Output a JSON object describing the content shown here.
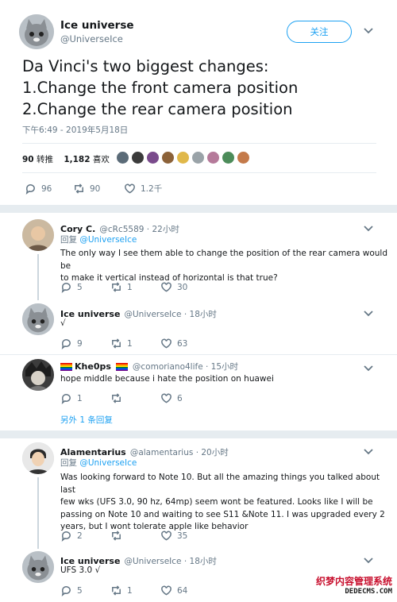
{
  "main_tweet": {
    "name": "Ice universe",
    "handle": "@UniverseIce",
    "follow_label": "关注",
    "text_line1": "Da Vinci's two biggest changes:",
    "text_line2": "1.Change the front camera position",
    "text_line3": "2.Change the rear camera position",
    "timestamp": "下午6:49 - 2019年5月18日",
    "retweets_count": "90",
    "retweets_label": "转推",
    "likes_count": "1,182",
    "likes_label": "喜欢",
    "actions": {
      "replies": "96",
      "retweets": "90",
      "likes": "1.2千"
    }
  },
  "replies": [
    {
      "name": "Cory C.",
      "handle_time": "@cRc5589 · 22小时",
      "reply_prefix": "回复",
      "reply_to": "@UniverseIce",
      "text_line1": "The only way I see them able to change the position of the rear camera would be",
      "text_line2": "to make it vertical instead of horizontal is that true?",
      "actions": {
        "replies": "5",
        "retweets": "1",
        "likes": "30"
      }
    },
    {
      "name": "Ice universe",
      "handle_time": "@UniverseIce · 18小时",
      "text_line1": "√",
      "actions": {
        "replies": "9",
        "retweets": "1",
        "likes": "63"
      }
    },
    {
      "name": "Khe0ps",
      "handle_time": "@comoriano4life · 15小时",
      "text_line1": "hope middle because i hate the position on huawei",
      "actions": {
        "replies": "1",
        "retweets": "",
        "likes": "6"
      },
      "more_replies": "另外 1 条回复"
    },
    {
      "name": "Alamentarius",
      "handle_time": "@alamentarius · 20小时",
      "reply_prefix": "回复",
      "reply_to": "@UniverseIce",
      "text_line1": "Was looking forward to Note 10. But all the amazing things you talked about  last",
      "text_line2": "few wks (UFS 3.0, 90 hz, 64mp) seem wont be featured. Looks like I will be",
      "text_line3": "passing on Note 10 and waiting to see S11 &Note 11. I was upgraded every 2",
      "text_line4": "years, but I wont tolerate apple like behavior",
      "actions": {
        "replies": "2",
        "retweets": "",
        "likes": "35"
      }
    },
    {
      "name": "Ice universe",
      "handle_time": "@UniverseIce · 18小时",
      "text_line1": "UFS 3.0 √",
      "actions": {
        "replies": "5",
        "retweets": "1",
        "likes": "64"
      }
    }
  ],
  "watermark": {
    "line1": "织梦内容管理系统",
    "line2": "DEDECMS.COM"
  },
  "colors": {
    "link": "#1da1f2",
    "muted": "#657786",
    "divider": "#e6ecf0",
    "watermark_red": "#c8102e"
  },
  "icons": [
    "reply-icon",
    "retweet-icon",
    "like-icon",
    "chevron-down-icon"
  ]
}
